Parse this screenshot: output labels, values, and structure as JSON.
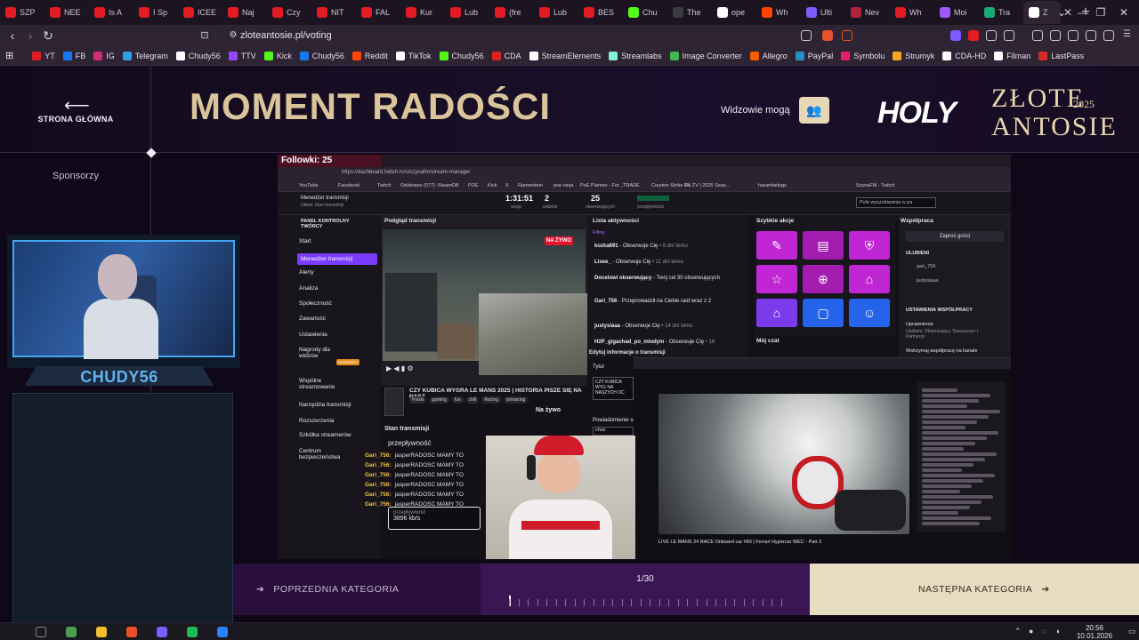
{
  "browser": {
    "tabs": [
      {
        "label": "SZP",
        "color": "#e31b23"
      },
      {
        "label": "NEE",
        "color": "#e31b23"
      },
      {
        "label": "Is A",
        "color": "#e31b23"
      },
      {
        "label": "I Sp",
        "color": "#e31b23"
      },
      {
        "label": "ICEE",
        "color": "#e31b23"
      },
      {
        "label": "Naj",
        "color": "#e31b23"
      },
      {
        "label": "Czy",
        "color": "#e31b23"
      },
      {
        "label": "NIT",
        "color": "#e31b23"
      },
      {
        "label": "FAL",
        "color": "#e31b23"
      },
      {
        "label": "Kur",
        "color": "#e31b23"
      },
      {
        "label": "Lub",
        "color": "#e31b23"
      },
      {
        "label": "(fre",
        "color": "#e31b23"
      },
      {
        "label": "Lub",
        "color": "#e31b23"
      },
      {
        "label": "BES",
        "color": "#e31b23"
      },
      {
        "label": "Chu",
        "color": "#53fc18"
      },
      {
        "label": "The",
        "color": "#3a3a3a"
      },
      {
        "label": "ope",
        "color": "#ffffff"
      },
      {
        "label": "Wh",
        "color": "#ff4500"
      },
      {
        "label": "Ulti",
        "color": "#7b5cff"
      },
      {
        "label": "Nev",
        "color": "#b0243b"
      },
      {
        "label": "Wh",
        "color": "#e31b23"
      },
      {
        "label": "Moi",
        "color": "#9b59ff"
      },
      {
        "label": "Tra",
        "color": "#19a974"
      }
    ],
    "active_tab": {
      "label": "Z",
      "color": "#ffffff"
    },
    "url": "zloteantosie.pl/voting",
    "bookmarks": [
      {
        "label": "YT",
        "color": "#e31b23"
      },
      {
        "label": "FB",
        "color": "#1877f2"
      },
      {
        "label": "IG",
        "color": "#d62976"
      },
      {
        "label": "Telegram",
        "color": "#2aa3e0"
      },
      {
        "label": "Chudy56",
        "color": "#ffffff"
      },
      {
        "label": "TTV",
        "color": "#9146ff"
      },
      {
        "label": "Kick",
        "color": "#53fc18"
      },
      {
        "label": "Chudy56",
        "color": "#1877f2"
      },
      {
        "label": "Reddit",
        "color": "#ff4500"
      },
      {
        "label": "TikTok",
        "color": "#ffffff"
      },
      {
        "label": "Chudy56",
        "color": "#53fc18"
      },
      {
        "label": "CDA",
        "color": "#d9241c"
      },
      {
        "label": "StreamElements",
        "color": "#ffffff"
      },
      {
        "label": "Streamlabs",
        "color": "#80f5d2"
      },
      {
        "label": "Image Converter",
        "color": "#3fb950"
      },
      {
        "label": "Allegro",
        "color": "#ff5a00"
      },
      {
        "label": "PayPal",
        "color": "#2790c3"
      },
      {
        "label": "Symbolu",
        "color": "#e91e63"
      },
      {
        "label": "Strumyk",
        "color": "#f5a623"
      },
      {
        "label": "CDA-HD",
        "color": "#ffffff"
      },
      {
        "label": "Filman",
        "color": "#ffffff"
      },
      {
        "label": "LastPass",
        "color": "#d32d27"
      }
    ]
  },
  "header": {
    "home_label": "STRONA GŁÓWNA",
    "title": "MOMENT RADOŚCI",
    "viewers_label": "Widzowie mogą",
    "logo_holy": "HOLY",
    "logo_line1": "ZŁOTE",
    "logo_line2": "ANTOSIE",
    "logo_year": "2025"
  },
  "sidebar": {
    "sponsors_label": "Sponsorzy"
  },
  "video": {
    "followers_text": "Followki: 25",
    "url_text": "https://dashboard.twitch.tv/u/szynafm/stream-manager",
    "bookmarks": [
      "YouTube",
      "Facebook",
      "Twitch",
      "Odebrane (577) -",
      "SteamDB",
      "POE",
      "Kick",
      "X",
      "Rammstein",
      "poe.ninja",
      "PoE Planner - For...",
      "TRADE",
      "Counter-Strike Re...",
      "F1 TV | 2025 Seas...",
      "harambelogs",
      "SzynaFM - Twitch"
    ],
    "top_stats": {
      "session_time": "1:31:51",
      "session_label": "sesja",
      "viewers": "2",
      "viewers_label": "widzów",
      "followers": "25",
      "followers_label": "obserwujących",
      "przeplywnosc_label": "przepływność"
    },
    "search_placeholder": "Pole wyszukiwania w pa",
    "nav_title": "PANEL KONTROLNY TWÓRCY",
    "manager_title": "Menedżer transmisji",
    "manager_sub": "Układ: Stan transmisji",
    "nav_items": [
      "Start",
      "Menedżer transmisji",
      "Alerty",
      "Analiza",
      "Społeczność",
      "Zawartość",
      "Ustawienia",
      "Nagrody dla widzów",
      "Wspólne streamowanie",
      "Narzędzia transmisji",
      "Rozszerzenia",
      "Szkółka streamerów",
      "Centrum bezpieczeństwa"
    ],
    "nav_badge": "NOWOŚCI",
    "preview_label": "Podgląd transmisji",
    "live_badge": "NA ŻYWO",
    "stream_title": "CZY KUBICA WYGRA LE MANS 2025 | HISTORIA PISZE SIĘ NA NASZ",
    "stream_tags": [
      "Polski",
      "gaming",
      "fun",
      "chill",
      "Racing",
      "simracing"
    ],
    "stan_label": "Stan transmisji",
    "przeplyw_label": "przepływność",
    "chat_lines": [
      {
        "user": "Gari_756:",
        "text": "jasperRADOSC MAMY TO"
      },
      {
        "user": "Gari_756:",
        "text": "jasperRADOSC MAMY TO"
      },
      {
        "user": "Gari_756:",
        "text": "jasperRADOSC MAMY TO"
      },
      {
        "user": "Gari_756:",
        "text": "jasperRADOSC MAMY TO"
      },
      {
        "user": "Gari_756:",
        "text": "jasperRADOSC MAMY TO"
      },
      {
        "user": "Gari_756:",
        "text": "jasperRADOSC MAMY TO"
      }
    ],
    "bitrate_label": "przepływność",
    "bitrate_value": "3896 kb/s",
    "activity_title": "Lista aktywności",
    "activity_filter": "Filtruj",
    "activity_items": [
      {
        "user": "kozka691",
        "text": " - Obserwuje Cię",
        "time": " • 8 dni temu"
      },
      {
        "user": "Lisee_",
        "text": " - Obserwuje Cię",
        "time": " • 11 dni temu"
      },
      {
        "user": "Docelowi obserwujący",
        "text": " - Twój cel 30 obserwujących",
        "time": ""
      },
      {
        "user": "Gari_756",
        "text": " - Przeprowadził na Ciebie raid wraz z 2",
        "time": ""
      },
      {
        "user": "justysiaaa",
        "text": " - Obserwuje Cię",
        "time": " • 14 dni temu"
      },
      {
        "user": "H2P_gigachad_po_mlodym",
        "text": " - Obserwuje Cię",
        "time": " • 16"
      }
    ],
    "quick_title": "Szybkie akcje",
    "quick_actions": [
      {
        "icon": "pencil-icon",
        "glyph": "✎",
        "color": "#c026d3"
      },
      {
        "icon": "clapper-icon",
        "glyph": "▤",
        "color": "#a21caf"
      },
      {
        "icon": "shield-icon",
        "glyph": "⛨",
        "color": "#c026d3"
      },
      {
        "icon": "star-icon",
        "glyph": "☆",
        "color": "#c026d3"
      },
      {
        "icon": "add-user-icon",
        "glyph": "⊕",
        "color": "#a21caf"
      },
      {
        "icon": "raid-icon",
        "glyph": "⌂",
        "color": "#c026d3"
      },
      {
        "icon": "raid2-icon",
        "glyph": "⌂",
        "color": "#7c3aed"
      },
      {
        "icon": "chat-icon",
        "glyph": "▢",
        "color": "#2563eb"
      },
      {
        "icon": "smile-icon",
        "glyph": "☺",
        "color": "#2563eb"
      }
    ],
    "my_chat_label": "Mój czat",
    "collab_title": "Współpraca",
    "collab_btn": "Zaproś gości",
    "favorites_label": "ULUBIENI",
    "favorites": [
      "gari_756",
      "justysiaaa"
    ],
    "collab_settings": "USTAWIENIA WSPÓŁPRACY",
    "collab_perm_title": "Uprawnienia",
    "collab_perm_sub": "Ulubieni, Obserwujący, Towarzysze i Partnerzy",
    "collab_share": "Wstrzymaj współpracę na kanale",
    "edit_info": "Edytuj informacje o transmisji",
    "title_field_label": "Tytuł",
    "title_field_value": "CZY KUBICA WYG NA NASZYCH OC",
    "notify_label": "Powiadomienie o",
    "notify_value": "choc",
    "onboard_title": "LIVE LE MANS 24 RACE Onboard car #83 | Ferrari Hypercar WEC - Part 2",
    "na_zywo_overlay": "Na żywo"
  },
  "webcam": {
    "name": "CHUDY56"
  },
  "bottom_nav": {
    "prev_label": "POPRZEDNIA KATEGORIA",
    "next_label": "NASTĘPNA KATEGORIA",
    "progress_text": "1/30",
    "current": 1,
    "total": 30
  },
  "taskbar": {
    "time": "20:56",
    "date": "10.01.2026"
  }
}
